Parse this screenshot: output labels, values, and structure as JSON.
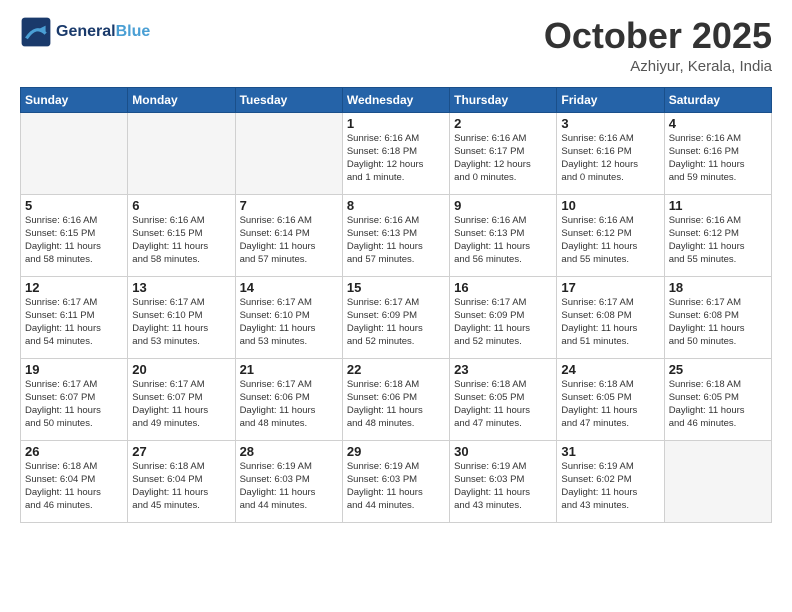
{
  "header": {
    "logo_line1": "General",
    "logo_line2": "Blue",
    "month": "October 2025",
    "location": "Azhiyur, Kerala, India"
  },
  "weekdays": [
    "Sunday",
    "Monday",
    "Tuesday",
    "Wednesday",
    "Thursday",
    "Friday",
    "Saturday"
  ],
  "weeks": [
    [
      {
        "day": "",
        "info": ""
      },
      {
        "day": "",
        "info": ""
      },
      {
        "day": "",
        "info": ""
      },
      {
        "day": "1",
        "info": "Sunrise: 6:16 AM\nSunset: 6:18 PM\nDaylight: 12 hours\nand 1 minute."
      },
      {
        "day": "2",
        "info": "Sunrise: 6:16 AM\nSunset: 6:17 PM\nDaylight: 12 hours\nand 0 minutes."
      },
      {
        "day": "3",
        "info": "Sunrise: 6:16 AM\nSunset: 6:16 PM\nDaylight: 12 hours\nand 0 minutes."
      },
      {
        "day": "4",
        "info": "Sunrise: 6:16 AM\nSunset: 6:16 PM\nDaylight: 11 hours\nand 59 minutes."
      }
    ],
    [
      {
        "day": "5",
        "info": "Sunrise: 6:16 AM\nSunset: 6:15 PM\nDaylight: 11 hours\nand 58 minutes."
      },
      {
        "day": "6",
        "info": "Sunrise: 6:16 AM\nSunset: 6:15 PM\nDaylight: 11 hours\nand 58 minutes."
      },
      {
        "day": "7",
        "info": "Sunrise: 6:16 AM\nSunset: 6:14 PM\nDaylight: 11 hours\nand 57 minutes."
      },
      {
        "day": "8",
        "info": "Sunrise: 6:16 AM\nSunset: 6:13 PM\nDaylight: 11 hours\nand 57 minutes."
      },
      {
        "day": "9",
        "info": "Sunrise: 6:16 AM\nSunset: 6:13 PM\nDaylight: 11 hours\nand 56 minutes."
      },
      {
        "day": "10",
        "info": "Sunrise: 6:16 AM\nSunset: 6:12 PM\nDaylight: 11 hours\nand 55 minutes."
      },
      {
        "day": "11",
        "info": "Sunrise: 6:16 AM\nSunset: 6:12 PM\nDaylight: 11 hours\nand 55 minutes."
      }
    ],
    [
      {
        "day": "12",
        "info": "Sunrise: 6:17 AM\nSunset: 6:11 PM\nDaylight: 11 hours\nand 54 minutes."
      },
      {
        "day": "13",
        "info": "Sunrise: 6:17 AM\nSunset: 6:10 PM\nDaylight: 11 hours\nand 53 minutes."
      },
      {
        "day": "14",
        "info": "Sunrise: 6:17 AM\nSunset: 6:10 PM\nDaylight: 11 hours\nand 53 minutes."
      },
      {
        "day": "15",
        "info": "Sunrise: 6:17 AM\nSunset: 6:09 PM\nDaylight: 11 hours\nand 52 minutes."
      },
      {
        "day": "16",
        "info": "Sunrise: 6:17 AM\nSunset: 6:09 PM\nDaylight: 11 hours\nand 52 minutes."
      },
      {
        "day": "17",
        "info": "Sunrise: 6:17 AM\nSunset: 6:08 PM\nDaylight: 11 hours\nand 51 minutes."
      },
      {
        "day": "18",
        "info": "Sunrise: 6:17 AM\nSunset: 6:08 PM\nDaylight: 11 hours\nand 50 minutes."
      }
    ],
    [
      {
        "day": "19",
        "info": "Sunrise: 6:17 AM\nSunset: 6:07 PM\nDaylight: 11 hours\nand 50 minutes."
      },
      {
        "day": "20",
        "info": "Sunrise: 6:17 AM\nSunset: 6:07 PM\nDaylight: 11 hours\nand 49 minutes."
      },
      {
        "day": "21",
        "info": "Sunrise: 6:17 AM\nSunset: 6:06 PM\nDaylight: 11 hours\nand 48 minutes."
      },
      {
        "day": "22",
        "info": "Sunrise: 6:18 AM\nSunset: 6:06 PM\nDaylight: 11 hours\nand 48 minutes."
      },
      {
        "day": "23",
        "info": "Sunrise: 6:18 AM\nSunset: 6:05 PM\nDaylight: 11 hours\nand 47 minutes."
      },
      {
        "day": "24",
        "info": "Sunrise: 6:18 AM\nSunset: 6:05 PM\nDaylight: 11 hours\nand 47 minutes."
      },
      {
        "day": "25",
        "info": "Sunrise: 6:18 AM\nSunset: 6:05 PM\nDaylight: 11 hours\nand 46 minutes."
      }
    ],
    [
      {
        "day": "26",
        "info": "Sunrise: 6:18 AM\nSunset: 6:04 PM\nDaylight: 11 hours\nand 46 minutes."
      },
      {
        "day": "27",
        "info": "Sunrise: 6:18 AM\nSunset: 6:04 PM\nDaylight: 11 hours\nand 45 minutes."
      },
      {
        "day": "28",
        "info": "Sunrise: 6:19 AM\nSunset: 6:03 PM\nDaylight: 11 hours\nand 44 minutes."
      },
      {
        "day": "29",
        "info": "Sunrise: 6:19 AM\nSunset: 6:03 PM\nDaylight: 11 hours\nand 44 minutes."
      },
      {
        "day": "30",
        "info": "Sunrise: 6:19 AM\nSunset: 6:03 PM\nDaylight: 11 hours\nand 43 minutes."
      },
      {
        "day": "31",
        "info": "Sunrise: 6:19 AM\nSunset: 6:02 PM\nDaylight: 11 hours\nand 43 minutes."
      },
      {
        "day": "",
        "info": ""
      }
    ]
  ]
}
